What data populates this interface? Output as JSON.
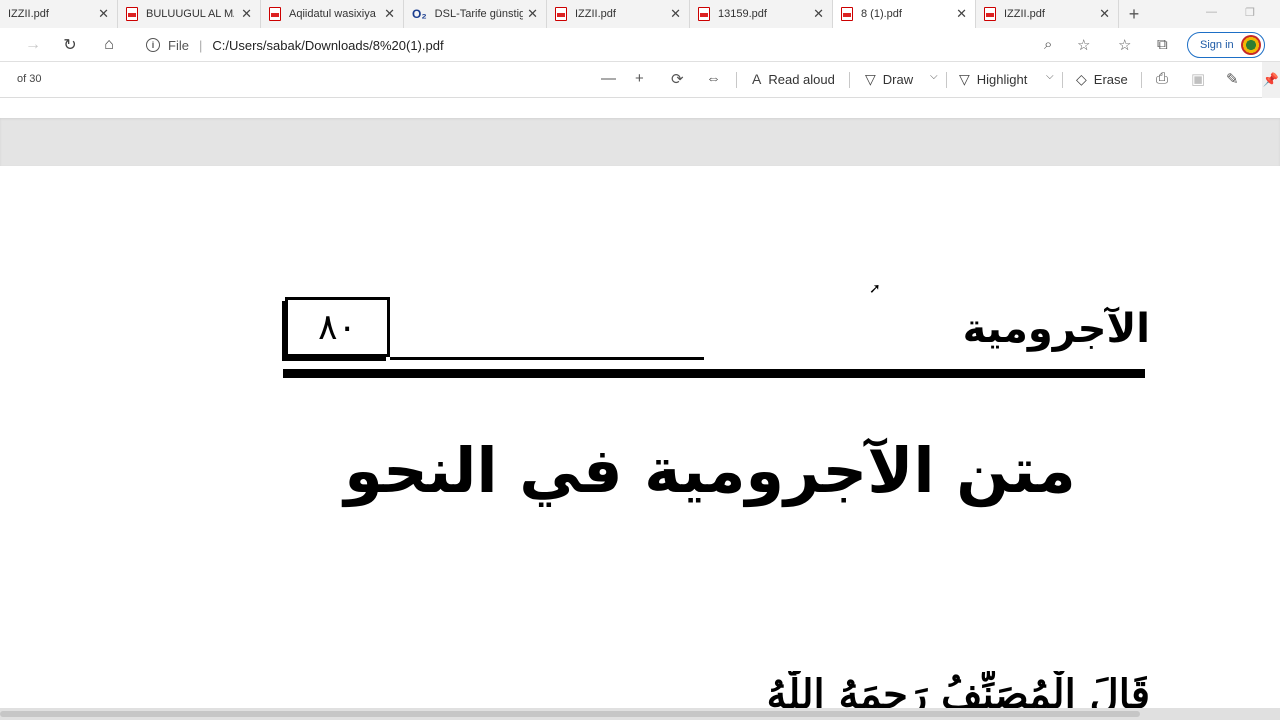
{
  "tabs": [
    {
      "label": "IZZII.pdf",
      "icon": "none",
      "active": false
    },
    {
      "label": "BULUUGUL AL MAR",
      "icon": "pdf-icon",
      "active": false
    },
    {
      "label": "Aqiidatul wasixiya",
      "icon": "pdf-icon",
      "active": false
    },
    {
      "label": "DSL-Tarife günstig",
      "icon": "o2-icon",
      "active": false
    },
    {
      "label": "IZZII.pdf",
      "icon": "pdf-icon",
      "active": false
    },
    {
      "label": "13159.pdf",
      "icon": "pdf-icon",
      "active": false
    },
    {
      "label": "8 (1).pdf",
      "icon": "pdf-icon",
      "active": true
    },
    {
      "label": "IZZII.pdf",
      "icon": "pdf-icon",
      "active": false
    }
  ],
  "address": {
    "file_label": "File",
    "url": "C:/Users/sabak/Downloads/8%20(1).pdf",
    "signin_label": "Sign in"
  },
  "pdf_toolbar": {
    "page_of": "of 30",
    "read_aloud": "Read aloud",
    "draw": "Draw",
    "highlight": "Highlight",
    "erase": "Erase"
  },
  "document": {
    "header_word": "الآجرومية",
    "page_number": "٨٠",
    "title": "متن الآجرومية في النحو",
    "body_start": "قَالَ الْمُصَنِّفُ رَحِمَهُ اللّٰهُ"
  },
  "colors": {
    "tabbar_bg": "#f3f3f3",
    "accent_blue": "#1d6fc6",
    "pdf_red": "#d22222"
  }
}
